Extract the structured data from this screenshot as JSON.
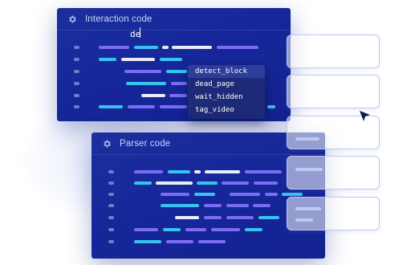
{
  "interaction_panel": {
    "title": "Interaction code",
    "icon": "gear-icon",
    "typed_text": "de",
    "autocomplete": [
      "detect_block",
      "dead_page",
      "wait_hidden",
      "tag_video"
    ],
    "selected_index": 0
  },
  "parser_panel": {
    "title": "Parser code",
    "icon": "gear-icon"
  },
  "colors": {
    "panel_bg": "#16279a",
    "accent_cyan": "#38c2f0",
    "accent_violet": "#7b6cf6",
    "autocomplete_bg": "#1d2a78",
    "card_border": "#bcc8f0"
  }
}
